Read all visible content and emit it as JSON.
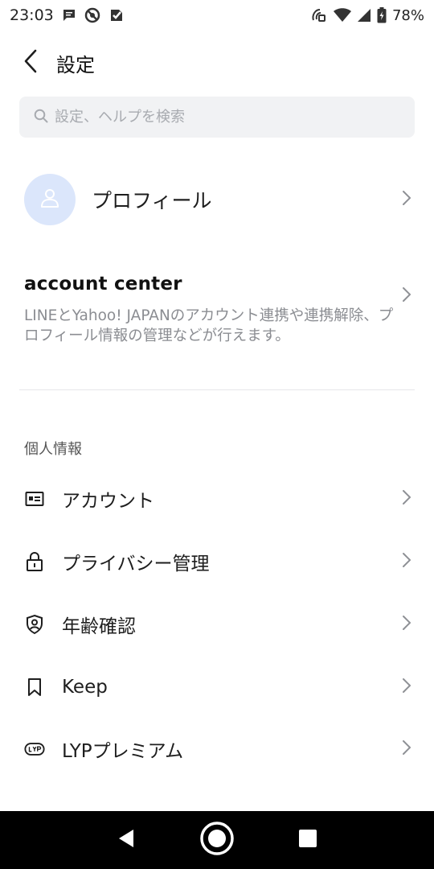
{
  "status_bar": {
    "time": "23:03",
    "battery_percent": "78%",
    "icons": [
      "message-icon",
      "no-disturb-icon",
      "check-app-icon",
      "nfc-icon",
      "wifi-icon",
      "cell-signal-icon",
      "battery-icon"
    ]
  },
  "header": {
    "title": "設定",
    "back_icon": "chevron-left-icon"
  },
  "search": {
    "placeholder": "設定、ヘルプを検索",
    "value": ""
  },
  "profile": {
    "label": "プロフィール"
  },
  "account_center": {
    "title": "account center",
    "description": "LINEとYahoo! JAPANのアカウント連携や連携解除、プロフィール情報の管理などが行えます。"
  },
  "section": {
    "title": "個人情報",
    "items": [
      {
        "label": "アカウント",
        "icon": "id-card-icon"
      },
      {
        "label": "プライバシー管理",
        "icon": "lock-icon"
      },
      {
        "label": "年齢確認",
        "icon": "shield-user-icon"
      },
      {
        "label": "Keep",
        "icon": "bookmark-icon"
      },
      {
        "label": "LYPプレミアム",
        "icon": "lyp-badge-icon"
      }
    ]
  },
  "colors": {
    "accent_avatar_bg": "#dbe6fb",
    "search_bg": "#f1f2f4",
    "secondary_text": "#8b8d92",
    "nav_bar": "#000000"
  }
}
